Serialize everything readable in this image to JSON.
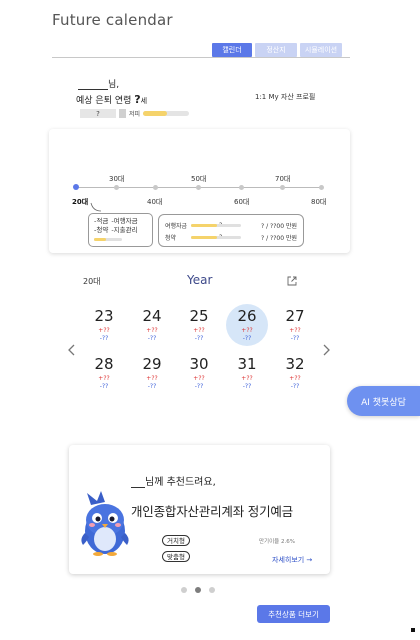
{
  "app": {
    "title": "Future calendar"
  },
  "tabs": [
    {
      "label": "캘린더",
      "active": true
    },
    {
      "label": "정산지",
      "active": false
    },
    {
      "label": "시뮬레이션",
      "active": false
    }
  ],
  "profile": {
    "name_suffix": "님,",
    "retire_label": "예상 은퇴 연령",
    "retire_value": "?",
    "retire_unit": "세",
    "asset_profile_label": "1:1 My 자산 프로필",
    "mini_value": "?",
    "mini_label": "저피",
    "mini_progress_value": "?",
    "mini_progress_fraction": 0.52
  },
  "timeline": {
    "upper_labels": [
      "30대",
      "50대",
      "70대"
    ],
    "lower_labels": [
      "20대",
      "40대",
      "60대",
      "80대"
    ],
    "current": "20대",
    "popup_left": {
      "rows": [
        [
          "-적금",
          "-여행자금"
        ],
        [
          "-청약",
          "-지출관리"
        ]
      ],
      "bar_value": "?",
      "bar_fraction": 0.42
    },
    "popup_right": [
      {
        "label": "여행자금",
        "bar_value": "?",
        "fraction": 0.52,
        "value": "? / ??00 만원"
      },
      {
        "label": "청약",
        "bar_value": "?",
        "fraction": 0.52,
        "value": "? / ??00 만원"
      }
    ]
  },
  "calendar": {
    "age_label": "20대",
    "year_label": "Year",
    "prev_icon": "chevron-left",
    "next_icon": "chevron-right",
    "days": [
      {
        "num": "23",
        "plus": "+??",
        "minus": "-??",
        "selected": false
      },
      {
        "num": "24",
        "plus": "+??",
        "minus": "-??",
        "selected": false
      },
      {
        "num": "25",
        "plus": "+??",
        "minus": "-??",
        "selected": false
      },
      {
        "num": "26",
        "plus": "+??",
        "minus": "-??",
        "selected": true
      },
      {
        "num": "27",
        "plus": "+??",
        "minus": "-??",
        "selected": false
      },
      {
        "num": "28",
        "plus": "+??",
        "minus": "-??",
        "selected": false
      },
      {
        "num": "29",
        "plus": "+??",
        "minus": "-??",
        "selected": false
      },
      {
        "num": "30",
        "plus": "+??",
        "minus": "-??",
        "selected": false
      },
      {
        "num": "31",
        "plus": "+??",
        "minus": "-??",
        "selected": false
      },
      {
        "num": "32",
        "plus": "+??",
        "minus": "-??",
        "selected": false
      }
    ]
  },
  "chatbot": {
    "label": "AI 챗봇상담"
  },
  "recommendation": {
    "greeting": "님께 추천드려요,",
    "product_name": "개인종합자산관리계좌 정기예금",
    "tags": [
      "거치형",
      "맞춤형"
    ],
    "rate": "만기이율 2.6%",
    "detail_link": "자세히보기 →"
  },
  "pager": {
    "count": 3,
    "active": 1
  },
  "more_button": {
    "label": "추천상품 더보기"
  },
  "colors": {
    "accent": "#5b78e8",
    "chatbot": "#6e91f0",
    "plus": "#d33333",
    "minus": "#3b5fd9"
  }
}
